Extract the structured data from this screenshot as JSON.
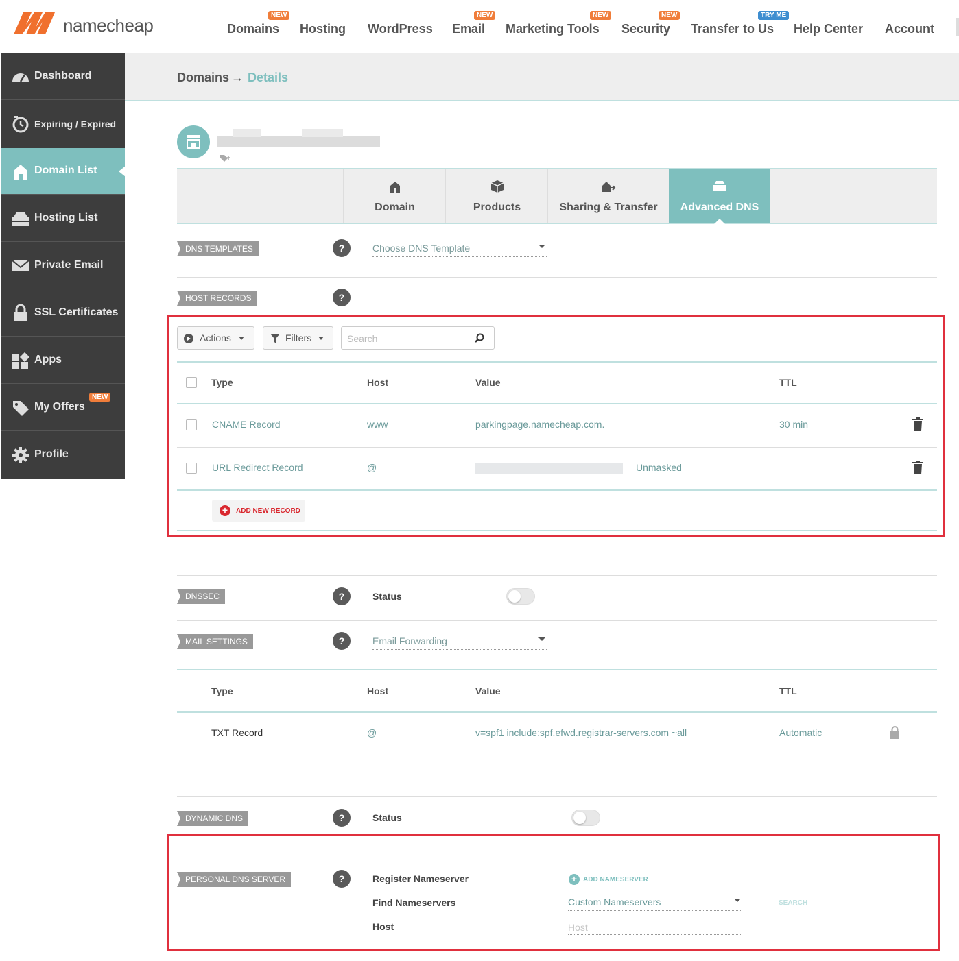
{
  "brand": {
    "name": "namecheap",
    "accent_color": "#7ebfbe",
    "logo_color": "#f0702e",
    "highlight_color": "#e0303e"
  },
  "nav": {
    "items": [
      {
        "label": "Domains",
        "badge": "NEW"
      },
      {
        "label": "Hosting",
        "badge": ""
      },
      {
        "label": "WordPress",
        "badge": ""
      },
      {
        "label": "Email",
        "badge": "NEW"
      },
      {
        "label": "Marketing Tools",
        "badge": "NEW"
      },
      {
        "label": "Security",
        "badge": "NEW"
      },
      {
        "label": "Transfer to Us",
        "badge": "TRY ME"
      },
      {
        "label": "Help Center",
        "badge": ""
      },
      {
        "label": "Account",
        "badge": ""
      }
    ]
  },
  "sidebar": {
    "items": [
      {
        "label": "Dashboard",
        "icon": "gauge-icon"
      },
      {
        "label": "Expiring / Expired",
        "icon": "timer-icon"
      },
      {
        "label": "Domain List",
        "icon": "home-icon",
        "active": true
      },
      {
        "label": "Hosting List",
        "icon": "server-icon"
      },
      {
        "label": "Private Email",
        "icon": "envelope-icon"
      },
      {
        "label": "SSL Certificates",
        "icon": "lock-icon"
      },
      {
        "label": "Apps",
        "icon": "apps-icon"
      },
      {
        "label": "My Offers",
        "icon": "tag-icon",
        "badge": "NEW"
      },
      {
        "label": "Profile",
        "icon": "gear-icon"
      }
    ]
  },
  "breadcrumb": {
    "root": "Domains",
    "separator": "→",
    "current": "Details"
  },
  "tabs": [
    {
      "label": "Domain",
      "icon": "home-icon"
    },
    {
      "label": "Products",
      "icon": "box-icon"
    },
    {
      "label": "Sharing & Transfer",
      "icon": "share-icon"
    },
    {
      "label": "Advanced DNS",
      "icon": "dns-icon",
      "active": true
    }
  ],
  "dns_templates": {
    "label": "DNS TEMPLATES",
    "help": "?",
    "select_value": "Choose DNS Template"
  },
  "host_records": {
    "label": "HOST RECORDS",
    "help": "?",
    "actions_label": "Actions",
    "filters_label": "Filters",
    "search_placeholder": "Search",
    "columns": [
      "Type",
      "Host",
      "Value",
      "TTL"
    ],
    "rows": [
      {
        "type": "CNAME Record",
        "host": "www",
        "value": "parkingpage.namecheap.com.",
        "ttl": "30 min"
      },
      {
        "type": "URL Redirect Record",
        "host": "@",
        "value": "",
        "extra": "Unmasked",
        "ttl": ""
      }
    ],
    "add_label": "ADD NEW RECORD"
  },
  "dnssec": {
    "label": "DNSSEC",
    "help": "?",
    "status_label": "Status",
    "enabled": false
  },
  "mail_settings": {
    "label": "MAIL SETTINGS",
    "help": "?",
    "select_value": "Email Forwarding",
    "columns": [
      "Type",
      "Host",
      "Value",
      "TTL"
    ],
    "rows": [
      {
        "type": "TXT Record",
        "host": "@",
        "value": "v=spf1 include:spf.efwd.registrar-servers.com ~all",
        "ttl": "Automatic"
      }
    ]
  },
  "dynamic_dns": {
    "label": "DYNAMIC DNS",
    "help": "?",
    "status_label": "Status",
    "enabled": false
  },
  "personal_dns": {
    "label": "PERSONAL DNS SERVER",
    "help": "?",
    "register_label": "Register Nameserver",
    "add_ns_label": "ADD NAMESERVER",
    "find_label": "Find Nameservers",
    "find_select": "Custom Nameservers",
    "search_label": "SEARCH",
    "host_label": "Host",
    "host_placeholder": "Host"
  }
}
